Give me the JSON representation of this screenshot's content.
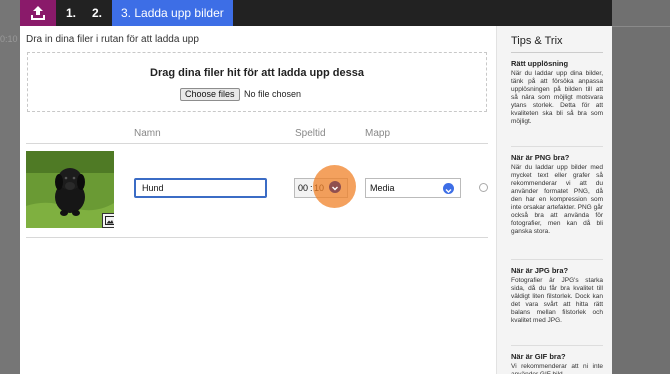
{
  "background": {
    "partial_time": "0:10"
  },
  "steps": [
    "1.",
    "2.",
    "3. Ladda upp bilder"
  ],
  "upload": {
    "instruction": "Dra in dina filer i rutan för att ladda upp",
    "drop_text": "Drag dina filer hit för att ladda upp dessa",
    "choose_button": "Choose files",
    "no_file": "No file chosen"
  },
  "columns": {
    "name": "Namn",
    "time": "Speltid",
    "folder": "Mapp"
  },
  "item": {
    "name": "Hund",
    "time_minutes": "00",
    "time_separator": ":",
    "time_seconds": "10",
    "folder": "Media"
  },
  "tips": {
    "title": "Tips & Trix",
    "sections": [
      {
        "heading": "Rätt upplösning",
        "body": "När du laddar upp dina bilder, tänk på att försöka anpassa upplösningen på bilden till att så nära som möjligt motsvara ytans storlek. Detta för att kvaliteten ska bli så bra som möjligt."
      },
      {
        "heading": "När är PNG bra?",
        "body": "När du laddar upp bilder med mycket text eller grafer så rekommenderar vi att du använder formatet PNG, då den har en kompression som inte orsakar artefakter. PNG går också bra att använda för fotografier, men kan då bli ganska stora."
      },
      {
        "heading": "När är JPG bra?",
        "body": "Fotografier är JPG's starka sida, då du får bra kvalitet till väldigt liten filstorlek. Dock kan det vara svårt att hitta rätt balans mellan filstorlek och kvalitet med JPG."
      },
      {
        "heading": "När är GIF bra?",
        "body": "Vi rekommenderar att ni inte använder GIF bild..."
      }
    ]
  },
  "colors": {
    "accent": "#3d6ee6",
    "upload_icon_bg": "#8a1a6a",
    "highlight": "#f08228",
    "topbar": "#222222"
  },
  "icons": {
    "upload": "upload-tray-icon",
    "image": "image-icon",
    "time_dropdown": "chevron-down-icon",
    "folder_dropdown": "chevron-down-icon",
    "drag": "drag-handle-icon"
  }
}
